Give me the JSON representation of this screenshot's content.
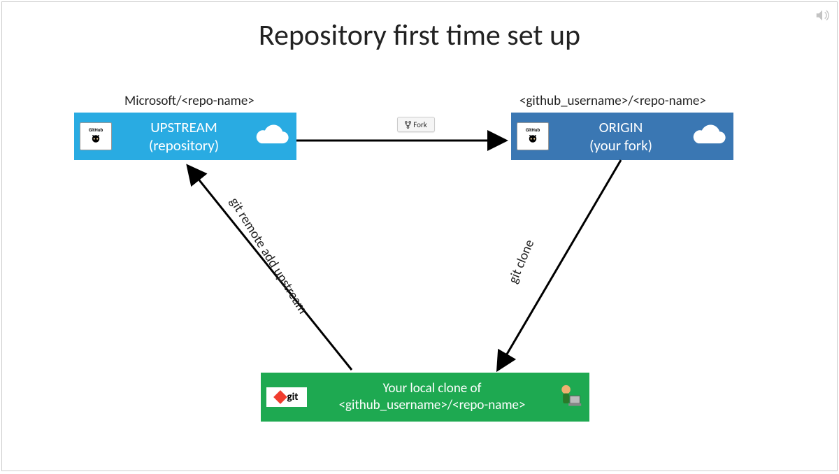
{
  "title": "Repository first time set up",
  "upstream": {
    "caption": "Microsoft/<repo-name>",
    "label_line1": "UPSTREAM",
    "label_line2": "(repository)",
    "badge": "GitHub"
  },
  "origin": {
    "caption": "<github_username>/<repo-name>",
    "label_line1": "ORIGIN",
    "label_line2": "(your fork)",
    "badge": "GitHub"
  },
  "local": {
    "label_line1": "Your local clone of",
    "label_line2": "<github_username>/<repo-name>",
    "badge": "git"
  },
  "arrows": {
    "fork_button": "Fork",
    "git_remote": "git remote add upstream",
    "git_clone": "git clone"
  },
  "colors": {
    "upstream": "#29abe2",
    "origin": "#3a77b3",
    "local": "#1ea951"
  }
}
